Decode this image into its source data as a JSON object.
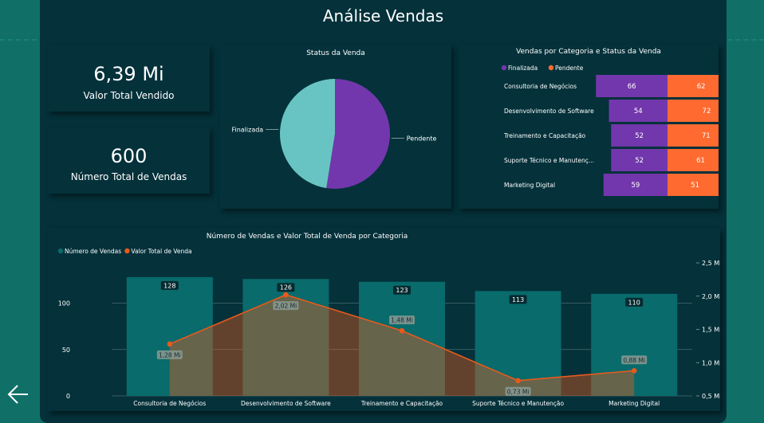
{
  "page_title": "Análise Vendas",
  "kpis": [
    {
      "value": "6,39 Mi",
      "label": "Valor Total Vendido"
    },
    {
      "value": "600",
      "label": "Número Total de Vendas"
    }
  ],
  "colors": {
    "finalizada": "#7237ac",
    "pendente": "#ff6a30",
    "teal_bar": "#096b6b",
    "line": "#e85a1c",
    "pie_light": "#68c4c2"
  },
  "chart_data": [
    {
      "type": "pie",
      "title": "Status da Venda",
      "slices": [
        {
          "label": "Pendente",
          "value": 0.525
        },
        {
          "label": "Finalizada",
          "value": 0.475
        }
      ]
    },
    {
      "type": "bar",
      "orientation": "horizontal",
      "stacked": true,
      "title": "Vendas por Categoria e Status da Venda",
      "categories": [
        "Consultoria de Negócios",
        "Desenvolvimento de Software",
        "Treinamento e Capacitação",
        "Suporte Técnico e Manutenç...",
        "Marketing Digital"
      ],
      "series": [
        {
          "name": "Finalizada",
          "values": [
            66,
            54,
            52,
            52,
            59
          ]
        },
        {
          "name": "Pendente",
          "values": [
            62,
            72,
            71,
            61,
            51
          ]
        }
      ],
      "legend": "top-left"
    },
    {
      "type": "bar",
      "title": "Número de Vendas e Valor Total de Venda por Categoria",
      "categories": [
        "Consultoria de Negócios",
        "Desenvolvimento de Software",
        "Treinamento e Capacitação",
        "Suporte Técnico e Manutenção",
        "Marketing Digital"
      ],
      "series": [
        {
          "name": "Número de Vendas",
          "type": "bar",
          "values": [
            128,
            126,
            123,
            113,
            110
          ],
          "labels": [
            "128",
            "126",
            "123",
            "113",
            "110"
          ]
        },
        {
          "name": "Valor Total de Venda",
          "type": "line",
          "values": [
            1.28,
            2.02,
            1.48,
            0.73,
            0.88
          ],
          "labels": [
            "1,28 Mi",
            "2,02 Mi",
            "1,48 Mi",
            "0,73 Mi",
            "0,88 Mi"
          ]
        }
      ],
      "y_left": {
        "ticks": [
          "0",
          "50",
          "100"
        ],
        "ylim": [
          0,
          140
        ]
      },
      "y_right": {
        "ticks": [
          "0,5 Mi",
          "1,0 Mi",
          "1,5 Mi",
          "2,0 Mi",
          "2,5 Mi"
        ],
        "ylim": [
          0.5,
          2.5
        ]
      },
      "legend": "top-left",
      "grid": true
    }
  ]
}
